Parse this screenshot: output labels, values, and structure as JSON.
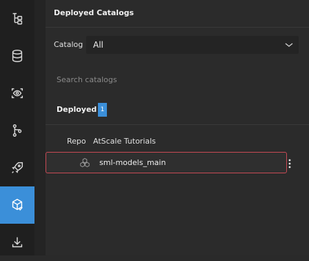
{
  "sidebar": {
    "items": [
      {
        "icon": "tree-structure-icon",
        "active": false
      },
      {
        "icon": "database-icon",
        "active": false
      },
      {
        "icon": "eye-icon",
        "active": false
      },
      {
        "icon": "git-branch-icon",
        "active": false
      },
      {
        "icon": "rocket-icon",
        "active": false
      },
      {
        "icon": "package-check-icon",
        "active": true
      },
      {
        "icon": "download-icon",
        "active": false
      }
    ],
    "accent_color": "#3b8fd9"
  },
  "panel": {
    "title": "Deployed Catalogs",
    "catalog_label": "Catalog",
    "catalog_value": "All",
    "search_placeholder": "Search catalogs",
    "section_title": "Deployed",
    "section_count": "1",
    "repo_label": "Repo",
    "repo_name": "AtScale Tutorials",
    "models": [
      {
        "name": "sml-models_main",
        "icon": "cubes-icon",
        "selected": true
      }
    ],
    "selected_border_color": "#c94a55"
  }
}
